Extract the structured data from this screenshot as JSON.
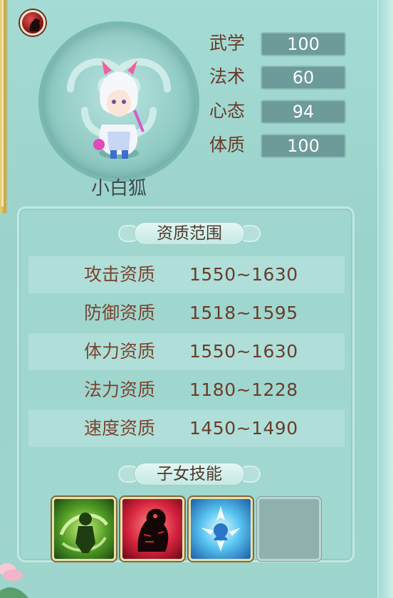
{
  "pet": {
    "name": "小白狐"
  },
  "stats": [
    {
      "label": "武学",
      "value": "100"
    },
    {
      "label": "法术",
      "value": "60"
    },
    {
      "label": "心态",
      "value": "94"
    },
    {
      "label": "体质",
      "value": "100"
    }
  ],
  "aptitude": {
    "title": "资质范围",
    "rows": [
      {
        "label": "攻击资质",
        "value": "1550~1630"
      },
      {
        "label": "防御资质",
        "value": "1518~1595"
      },
      {
        "label": "体力资质",
        "value": "1550~1630"
      },
      {
        "label": "法力资质",
        "value": "1180~1228"
      },
      {
        "label": "速度资质",
        "value": "1450~1490"
      }
    ]
  },
  "skills": {
    "title": "子女技能",
    "slots": [
      {
        "icon": "green-wind-skill-icon"
      },
      {
        "icon": "red-beast-skill-icon"
      },
      {
        "icon": "blue-ice-skill-icon"
      },
      {
        "icon": "empty-slot"
      }
    ]
  },
  "colors": {
    "background": "#9fd6cf",
    "stat_box": "#6c9b99",
    "label_brown": "#7a4430"
  }
}
